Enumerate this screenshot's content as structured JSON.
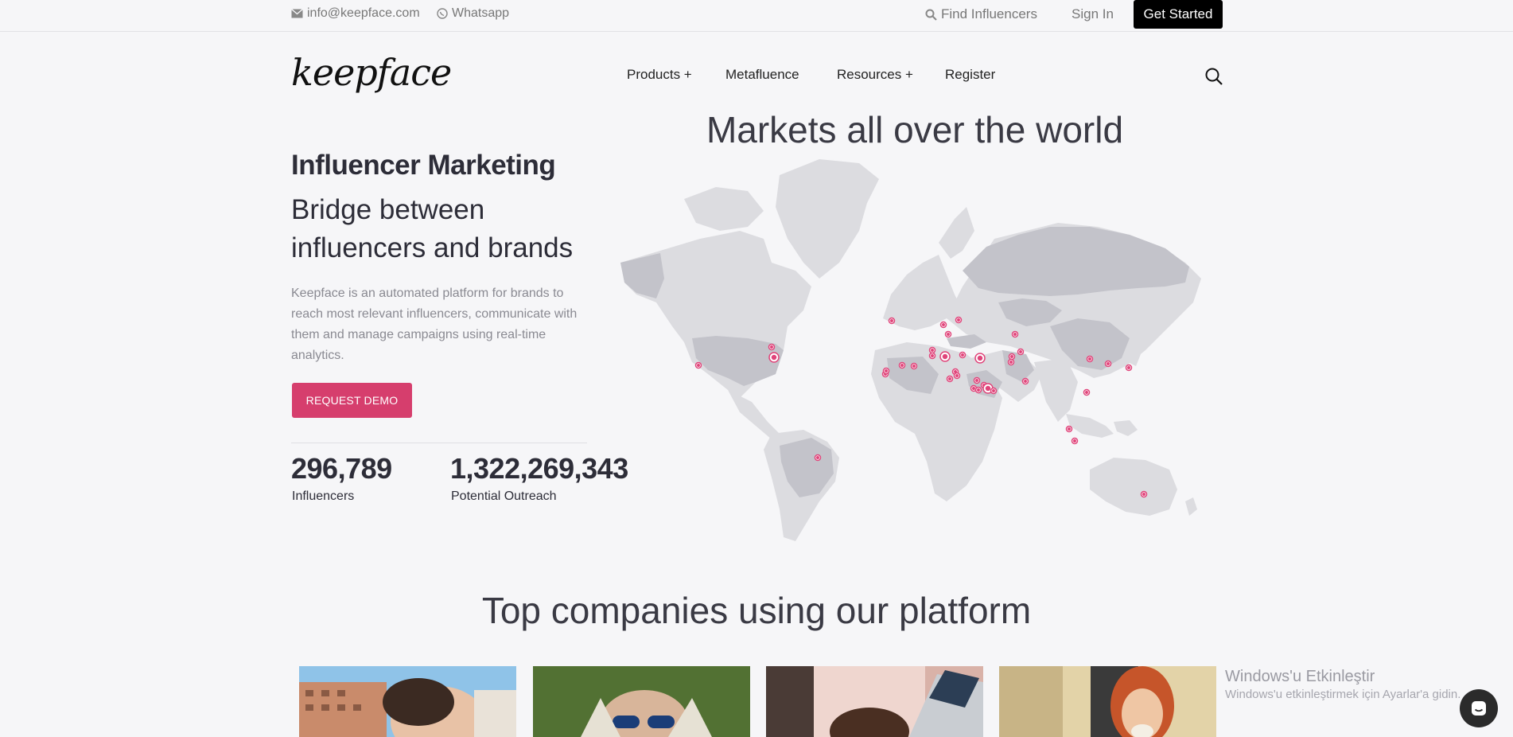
{
  "topbar": {
    "email": "info@keepface.com",
    "whatsapp": "Whatsapp",
    "find_influencers": "Find Influencers",
    "sign_in": "Sign In",
    "get_started": "Get Started"
  },
  "nav": {
    "logo": "keepface",
    "items": [
      "Products +",
      "Metafluence",
      "Resources +",
      "Register"
    ]
  },
  "hero": {
    "title": "Influencer Marketing",
    "subtitle": "Bridge between influencers and brands",
    "description": "Keepface is an automated platform for brands to reach most relevant influencers, communicate with them and manage campaigns using real-time analytics.",
    "cta": "REQUEST DEMO",
    "stats": [
      {
        "value": "296,789",
        "label": "Influencers"
      },
      {
        "value": "1,322,269,343",
        "label": "Potential Outreach"
      }
    ]
  },
  "map": {
    "title": "Markets all over the world",
    "marker_color": "#e0447a",
    "land_color": "#dcdce0",
    "highlight_color": "#c3c3ca"
  },
  "companies": {
    "title": "Top companies using our platform"
  },
  "windows_notice": {
    "title": "Windows'u Etkinleştir",
    "subtitle": "Windows'u etkinleştirmek için Ayarlar'a gidin."
  },
  "colors": {
    "accent": "#d63e6d",
    "dark": "#2d2d38",
    "background": "#f6f6f8"
  }
}
